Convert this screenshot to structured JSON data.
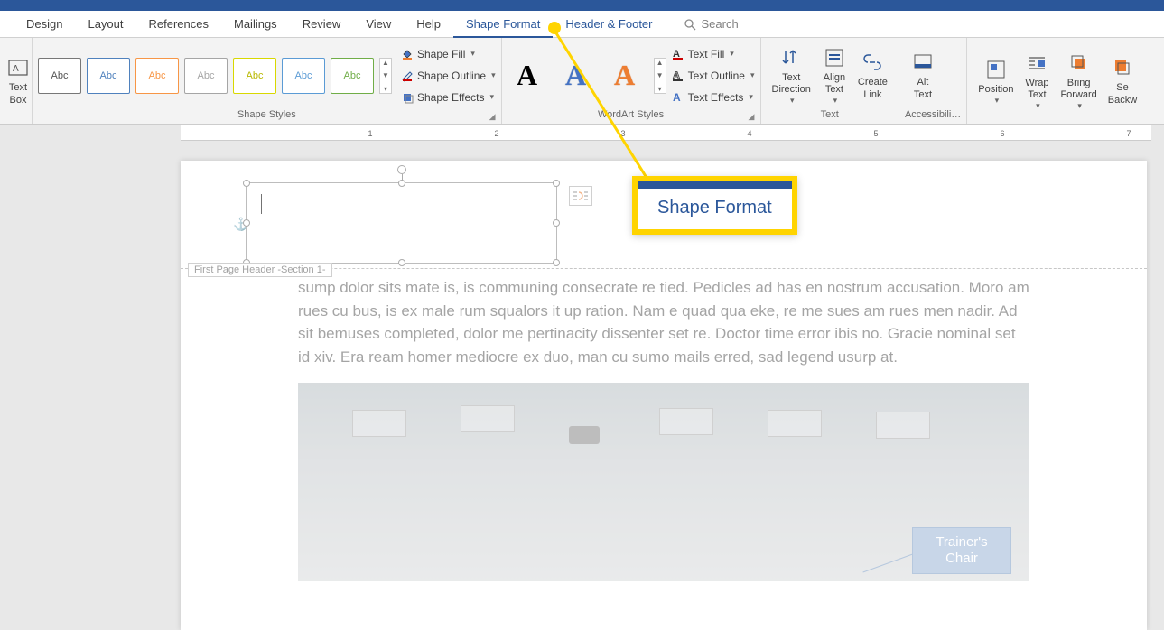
{
  "tabs": {
    "design": "Design",
    "layout": "Layout",
    "references": "References",
    "mailings": "Mailings",
    "review": "Review",
    "view": "View",
    "help": "Help",
    "shape_format": "Shape Format",
    "header_footer": "Header & Footer"
  },
  "search": {
    "placeholder": "Search"
  },
  "ribbon": {
    "insert_shapes": {
      "text_box": "Text\nBox"
    },
    "shape_styles": {
      "label": "Shape Styles",
      "sample": "Abc",
      "fill": "Shape Fill",
      "outline": "Shape Outline",
      "effects": "Shape Effects"
    },
    "wordart": {
      "label": "WordArt Styles",
      "sample": "A",
      "fill": "Text Fill",
      "outline": "Text Outline",
      "effects": "Text Effects"
    },
    "text": {
      "label": "Text",
      "direction": "Text\nDirection",
      "align": "Align\nText",
      "link": "Create\nLink"
    },
    "accessibility": {
      "label": "Accessibili…",
      "alt": "Alt\nText"
    },
    "arrange": {
      "position": "Position",
      "wrap": "Wrap\nText",
      "bring": "Bring\nForward",
      "send": "Se\nBackw"
    }
  },
  "ruler_numbers": [
    "1",
    "2",
    "3",
    "4",
    "5",
    "6",
    "7"
  ],
  "document": {
    "header_tag": "First Page Header -Section 1-",
    "body": "sump dolor sits mate is, is communing consecrate re tied. Pedicles ad has en nostrum accusation. Moro am rues cu bus, is ex male rum squalors it up ration. Nam e quad qua eke, re me sues am rues men nadir. Ad sit bemuses completed, dolor me pertinacity dissenter set re. Doctor time error ibis no. Gracie nominal set id xiv. Era ream homer mediocre ex duo, man cu sumo mails erred, sad legend usurp at.",
    "image_callout": "Trainer's\nChair"
  },
  "annotation": {
    "label": "Shape Format"
  }
}
